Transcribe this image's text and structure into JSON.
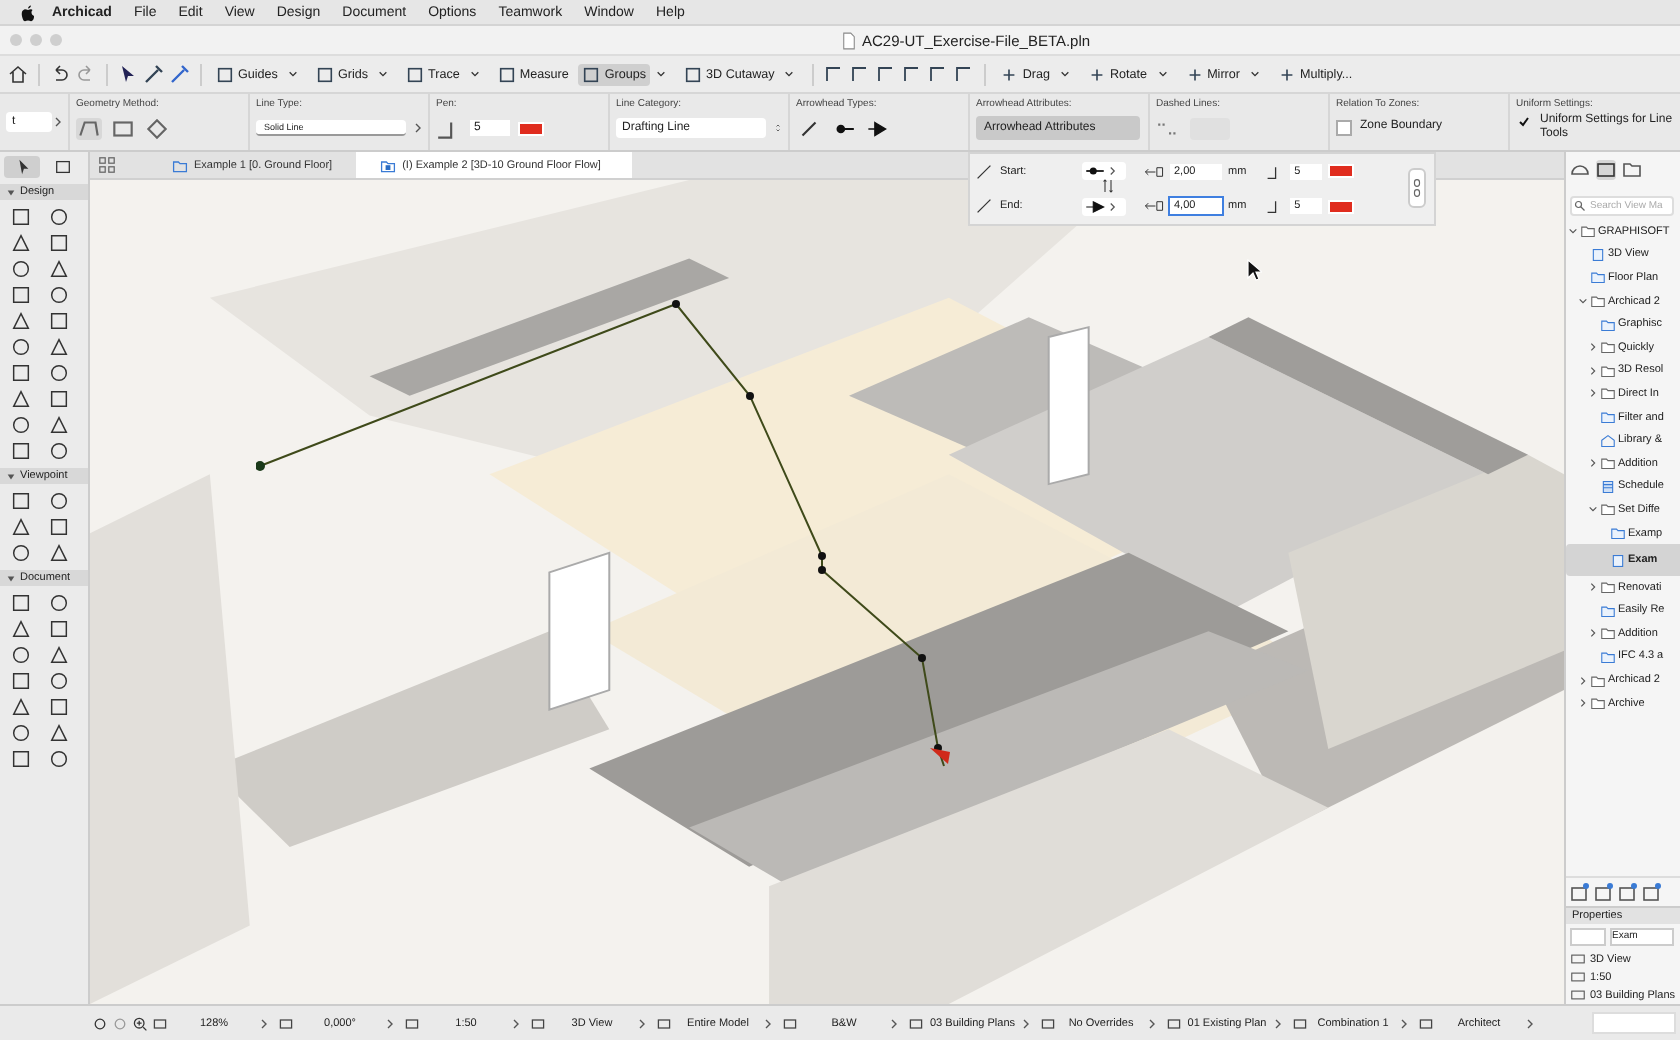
{
  "menu_bar": {
    "items": [
      {
        "label": "Archicad",
        "kind": "app"
      },
      {
        "label": "File",
        "kind": "menu"
      },
      {
        "label": "Edit",
        "kind": "menu"
      },
      {
        "label": "View",
        "kind": "menu"
      },
      {
        "label": "Design",
        "kind": "menu"
      },
      {
        "label": "Document",
        "kind": "menu"
      },
      {
        "label": "Options",
        "kind": "menu"
      },
      {
        "label": "Teamwork",
        "kind": "menu"
      },
      {
        "label": "Window",
        "kind": "menu"
      },
      {
        "label": "Help",
        "kind": "menu"
      }
    ]
  },
  "window": {
    "title": "AC29-UT_Exercise-File_BETA.pln"
  },
  "toolbar": {
    "tools": [
      {
        "label": "Guides",
        "dropdown": true,
        "selected": false
      },
      {
        "label": "Grids",
        "dropdown": true,
        "selected": false
      },
      {
        "label": "Trace",
        "dropdown": true,
        "selected": false
      },
      {
        "label": "Measure",
        "dropdown": false,
        "selected": false
      },
      {
        "label": "Groups",
        "dropdown": true,
        "selected": true
      },
      {
        "label": "3D Cutaway",
        "dropdown": true,
        "selected": false
      }
    ],
    "edit_tools": [
      {
        "label": "Drag",
        "dropdown": true,
        "selected": false
      },
      {
        "label": "Rotate",
        "dropdown": true,
        "selected": false
      },
      {
        "label": "Mirror",
        "dropdown": true,
        "selected": false
      },
      {
        "label": "Multiply...",
        "dropdown": false,
        "selected": false
      }
    ]
  },
  "info_box": {
    "first_field": "t",
    "geometry_method": {
      "label": "Geometry Method:"
    },
    "line_type": {
      "label": "Line Type:",
      "value": "Solid Line"
    },
    "pen": {
      "label": "Pen:",
      "value": "5"
    },
    "line_category": {
      "label": "Line Category:",
      "value": "Drafting Line"
    },
    "arrowhead_types": {
      "label": "Arrowhead Types:"
    },
    "arrowhead_attributes": {
      "label": "Arrowhead Attributes:",
      "button": "Arrowhead Attributes",
      "selected": true
    },
    "dashed_lines": {
      "label": "Dashed Lines:"
    },
    "relation_to_zones": {
      "label": "Relation To Zones:",
      "checkbox": "Zone Boundary",
      "checked": false
    },
    "uniform_settings": {
      "label": "Uniform Settings:",
      "checkbox": "Uniform Settings for Line Tools",
      "checked": true
    }
  },
  "tabs": [
    {
      "label": "Example 1 [0. Ground Floor]",
      "kind": "plan",
      "selected": false
    },
    {
      "label": "(I) Example 2 [3D-10 Ground Floor Flow]",
      "kind": "model",
      "selected": true
    }
  ],
  "toolbox": {
    "sections": [
      {
        "title": "Design",
        "expanded": true
      },
      {
        "title": "Viewpoint",
        "expanded": true
      },
      {
        "title": "Document",
        "expanded": true
      }
    ]
  },
  "arrowhead_popup": {
    "rows": [
      {
        "label": "Start:",
        "length": "2,00",
        "unit": "mm",
        "pen": "5",
        "focused": false
      },
      {
        "label": "End:",
        "length": "4,00",
        "unit": "mm",
        "pen": "5",
        "focused": true
      }
    ]
  },
  "navigator": {
    "search": {
      "placeholder": "Search View Ma"
    },
    "tree": [
      {
        "label": "GRAPHISOFT",
        "kind": "folder",
        "expanded": true,
        "selected": false,
        "children": [
          {
            "label": "3D View",
            "kind": "model",
            "selected": false
          },
          {
            "label": "Floor Plan",
            "kind": "plan",
            "selected": false
          },
          {
            "label": "Archicad 2",
            "kind": "folder",
            "expanded": true,
            "selected": false,
            "children": [
              {
                "label": "Graphisc",
                "kind": "plan",
                "selected": false
              },
              {
                "label": "Quickly",
                "kind": "folder",
                "expanded": false,
                "selected": false
              },
              {
                "label": "3D Resol",
                "kind": "folder",
                "expanded": false,
                "selected": false
              },
              {
                "label": "Direct In",
                "kind": "folder",
                "expanded": false,
                "selected": false
              },
              {
                "label": "Filter and",
                "kind": "plan",
                "selected": false
              },
              {
                "label": "Library &",
                "kind": "library",
                "selected": false
              },
              {
                "label": "Addition",
                "kind": "folder",
                "expanded": false,
                "selected": false
              },
              {
                "label": "Schedule",
                "kind": "schedule",
                "selected": false
              },
              {
                "label": "Set Diffe",
                "kind": "folder",
                "expanded": true,
                "selected": false,
                "children": [
                  {
                    "label": "Examp",
                    "kind": "plan",
                    "selected": false
                  },
                  {
                    "label": "Exam",
                    "kind": "model",
                    "selected": true
                  }
                ]
              },
              {
                "label": "Renovati",
                "kind": "folder",
                "expanded": false,
                "selected": false
              },
              {
                "label": "Easily Re",
                "kind": "plan",
                "selected": false
              },
              {
                "label": "Addition",
                "kind": "folder",
                "expanded": false,
                "selected": false
              },
              {
                "label": "IFC 4.3 a",
                "kind": "plan",
                "selected": false
              }
            ]
          },
          {
            "label": "Archicad 2",
            "kind": "folder",
            "expanded": false,
            "selected": false
          },
          {
            "label": "Archive",
            "kind": "folder",
            "expanded": false,
            "selected": false
          }
        ]
      }
    ],
    "properties": {
      "title": "Properties",
      "name_value": "Exam",
      "rows": [
        "3D View",
        "1:50",
        "03 Building Plans"
      ]
    }
  },
  "status_bar": {
    "items": [
      "128%",
      "0,000°",
      "1:50",
      "3D View",
      "Entire Model",
      "B&W",
      "03 Building Plans",
      "No Overrides",
      "01 Existing Plan",
      "Combination 1",
      "Architect"
    ]
  }
}
